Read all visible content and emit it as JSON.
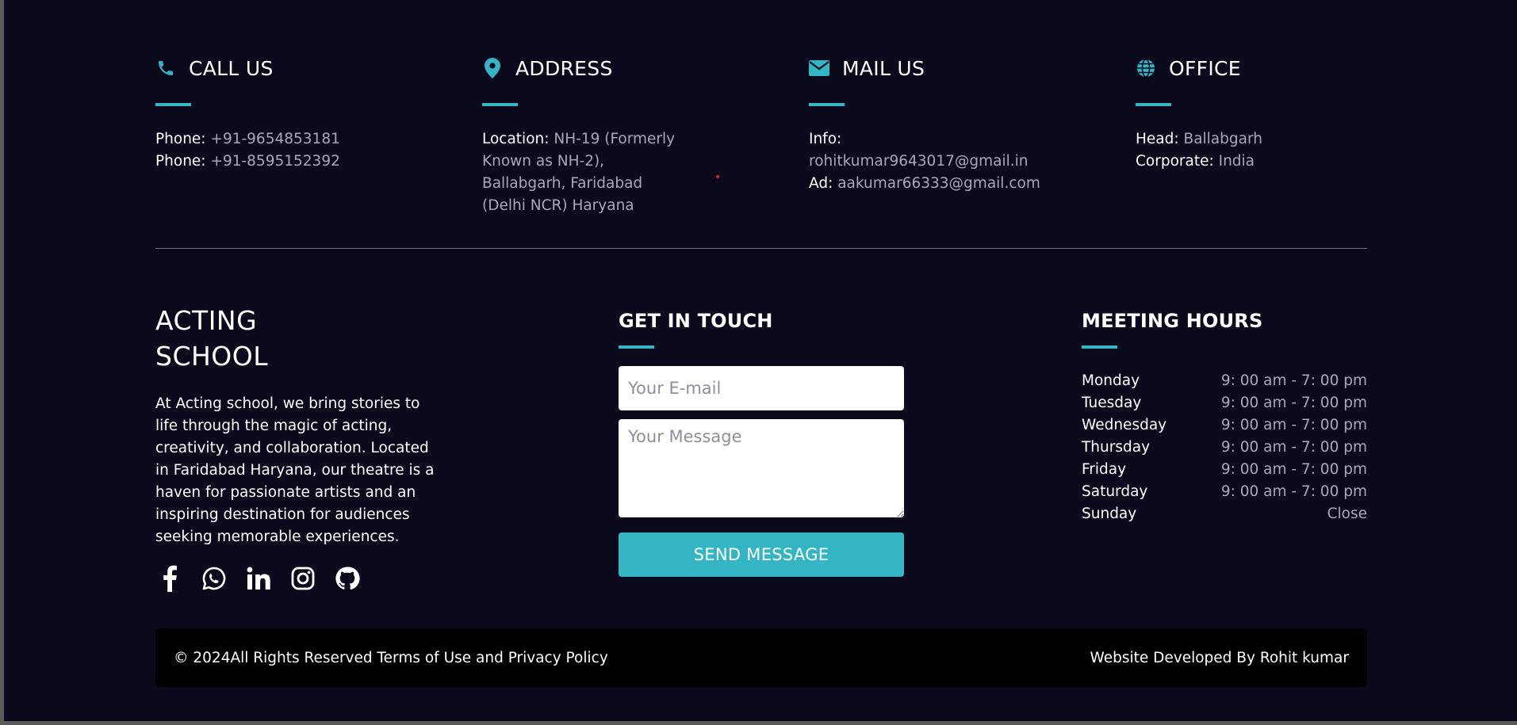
{
  "colors": {
    "accent": "#34b5c3",
    "background": "#0b0a1c",
    "footer": "#000000",
    "muted": "#a6a9bb"
  },
  "contact": [
    {
      "icon": "phone-icon",
      "title": "CALL US",
      "lines": [
        {
          "k": "Phone:",
          "v": "+91-9654853181"
        },
        {
          "k": "Phone:",
          "v": "+91-8595152392"
        }
      ]
    },
    {
      "icon": "location-pin-icon",
      "title": "ADDRESS",
      "lines": [
        {
          "k": "Location:",
          "v": "NH-19 (Formerly Known as NH-2), Ballabgarh, Faridabad"
        },
        {
          "k": "",
          "v": "(Delhi NCR) Haryana"
        }
      ]
    },
    {
      "icon": "envelope-icon",
      "title": "MAIL US",
      "lines": [
        {
          "k": "Info:",
          "v": "rohitkumar9643017@gmail.in"
        },
        {
          "k": "Ad:",
          "v": "aakumar66333@gmail.com"
        }
      ]
    },
    {
      "icon": "globe-icon",
      "title": "OFFICE",
      "lines": [
        {
          "k": "Head:",
          "v": "Ballabgarh"
        },
        {
          "k": "Corporate:",
          "v": "India"
        }
      ]
    }
  ],
  "brand": {
    "name_line1": "ACTING",
    "name_line2": "SCHOOL",
    "description": "At Acting school, we bring stories to life through the magic of acting, creativity, and collaboration. Located in Faridabad Haryana, our theatre is a haven for passionate artists and an inspiring destination for audiences seeking memorable experiences."
  },
  "socials": [
    "facebook-icon",
    "whatsapp-icon",
    "linkedin-icon",
    "instagram-icon",
    "github-icon"
  ],
  "touch": {
    "title": "GET IN TOUCH",
    "email_placeholder": "Your E-mail",
    "message_placeholder": "Your Message",
    "send_label": "SEND MESSAGE"
  },
  "hours": {
    "title": "MEETING HOURS",
    "rows": [
      {
        "day": "Monday",
        "time": "9: 00 am - 7: 00 pm"
      },
      {
        "day": "Tuesday",
        "time": "9: 00 am - 7: 00 pm"
      },
      {
        "day": "Wednesday",
        "time": "9: 00 am - 7: 00 pm"
      },
      {
        "day": "Thursday",
        "time": "9: 00 am - 7: 00 pm"
      },
      {
        "day": "Friday",
        "time": "9: 00 am - 7: 00 pm"
      },
      {
        "day": "Saturday",
        "time": "9: 00 am - 7: 00 pm"
      },
      {
        "day": "Sunday",
        "time": "Close"
      }
    ]
  },
  "footer": {
    "left": "© 2024All Rights Reserved Terms of Use and Privacy Policy",
    "right": "Website Developed By Rohit kumar"
  }
}
